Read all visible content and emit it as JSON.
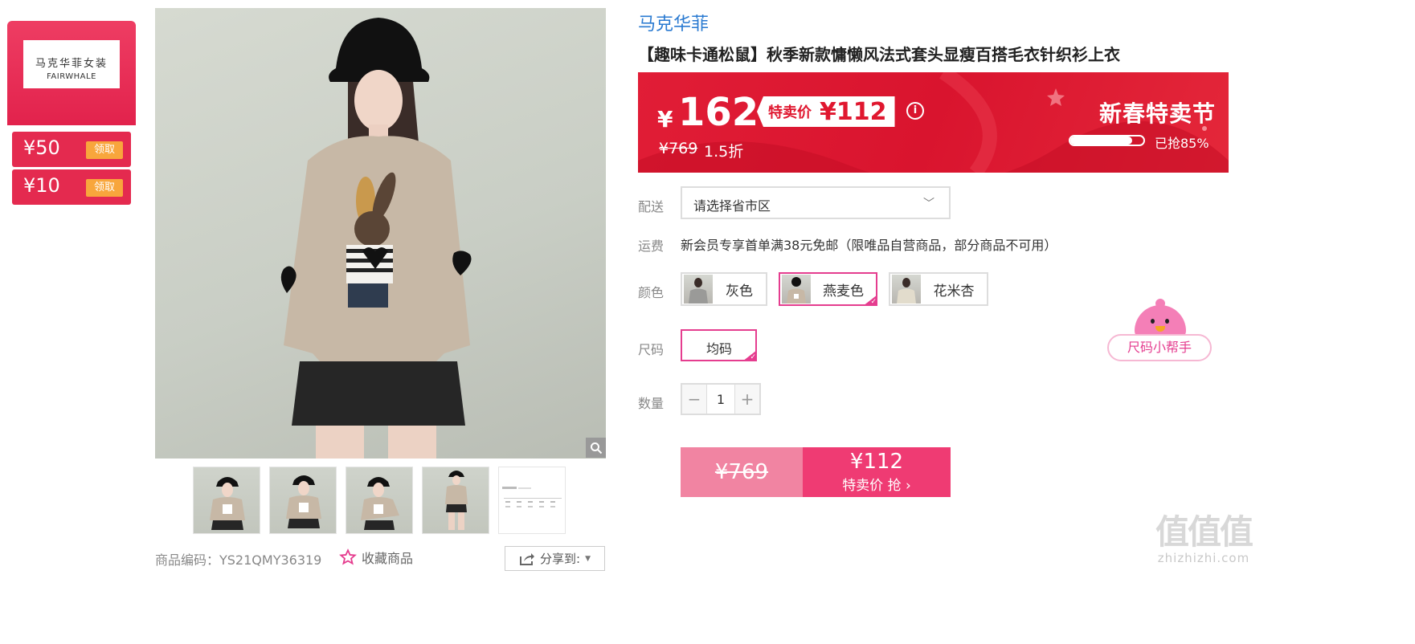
{
  "coupons": {
    "brand_cn": "马克华菲女装",
    "brand_en": "FAIRWHALE",
    "items": [
      {
        "amount": "¥50",
        "action": "领取"
      },
      {
        "amount": "¥10",
        "action": "领取"
      }
    ]
  },
  "gallery": {
    "thumbnails": [
      "model-front",
      "model-side",
      "model-pose",
      "model-full",
      "size-chart"
    ]
  },
  "meta": {
    "sku_label": "商品编码：YS21QMY36319",
    "favorite_label": "收藏商品",
    "share_label": "分享到:"
  },
  "product": {
    "brand": "马克华菲",
    "title": "【趣味卡通松鼠】秋季新款慵懒风法式套头显瘦百搭毛衣针织衫上衣"
  },
  "price": {
    "currency": "¥",
    "current": "162",
    "sale_label": "特卖价",
    "sale_price": "¥112",
    "info_icon": "i",
    "original": "¥769",
    "discount": "1.5折",
    "event_title": "新春特卖节",
    "sold_text": "已抢85%",
    "sold_fraction": 0.85
  },
  "delivery": {
    "label": "配送",
    "placeholder": "请选择省市区",
    "chevron": "﹀"
  },
  "shipping": {
    "label": "运费",
    "text": "新会员专享首单满38元免邮（限唯品自营商品，部分商品不可用）"
  },
  "colors": {
    "label": "颜色",
    "options": [
      {
        "name": "灰色",
        "selected": false
      },
      {
        "name": "燕麦色",
        "selected": true
      },
      {
        "name": "花米杏",
        "selected": false
      }
    ]
  },
  "size": {
    "label": "尺码",
    "option": "均码",
    "helper": "尺码小帮手"
  },
  "quantity": {
    "label": "数量",
    "minus": "−",
    "value": "1",
    "plus": "+"
  },
  "buy": {
    "original": "¥769",
    "price": "¥112",
    "action": "特卖价 抢 ›"
  },
  "watermark": {
    "glyphs": "值值值",
    "site": "zhizhizhi.com"
  },
  "colors_theme": {
    "accent_red": "#e0172f",
    "accent_pink": "#e53d8f",
    "link_blue": "#2a7ad1"
  }
}
